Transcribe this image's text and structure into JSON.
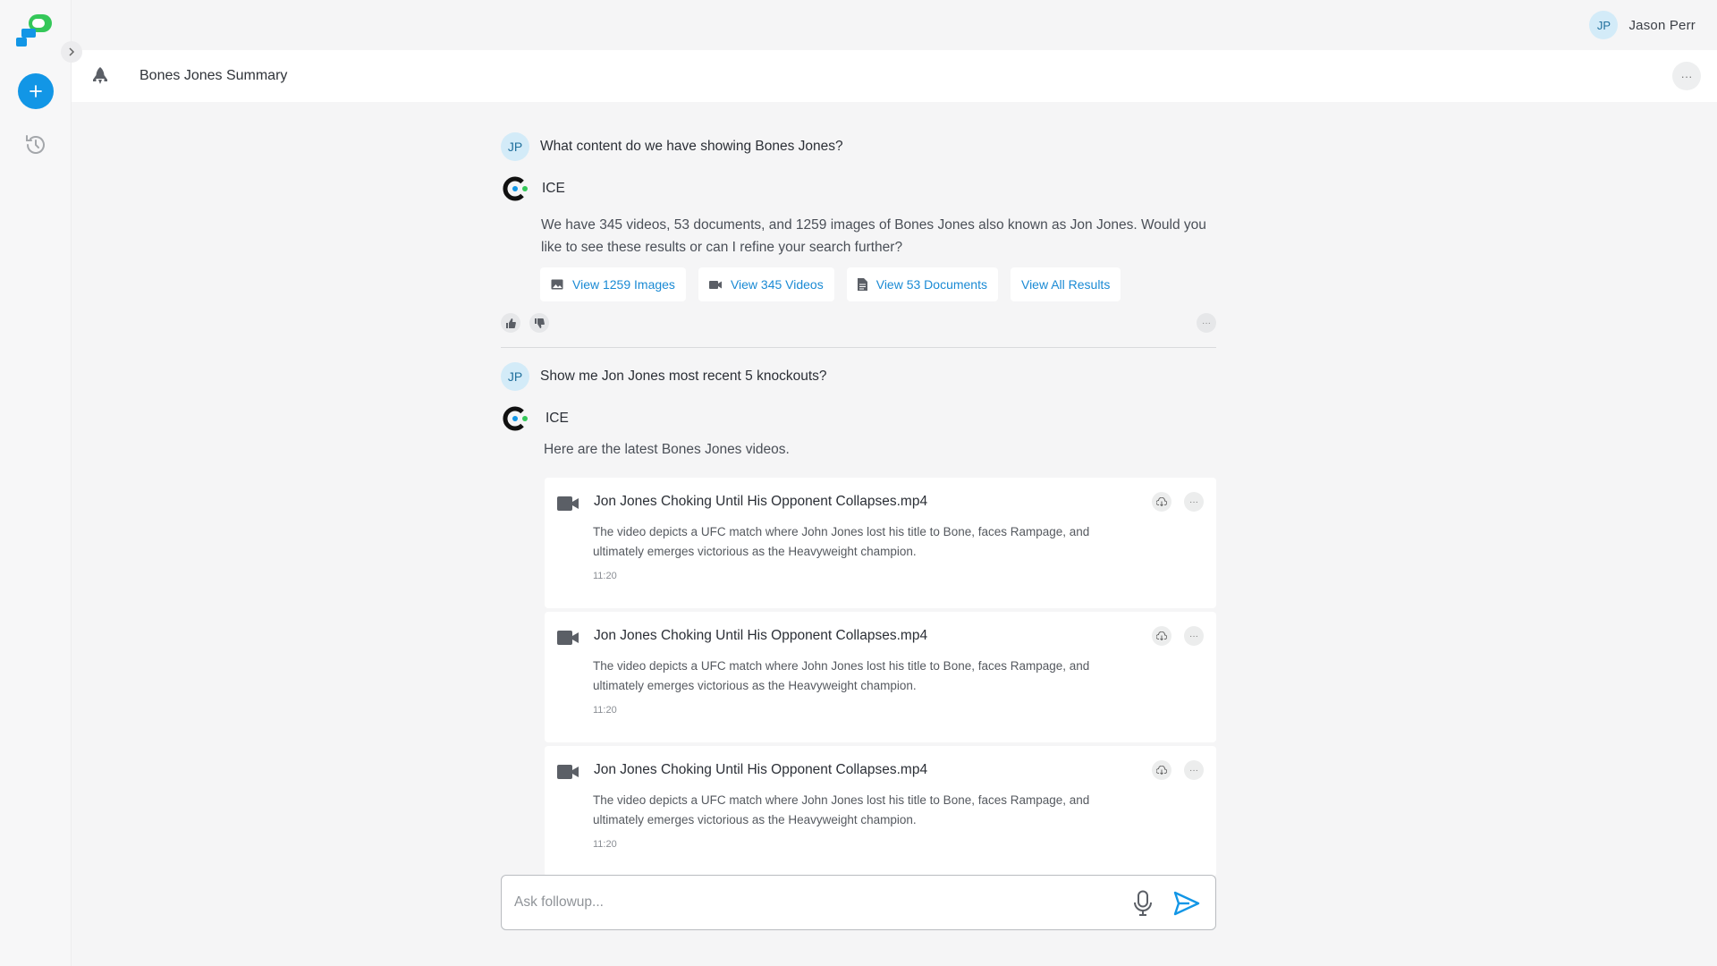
{
  "user": {
    "initials": "JP",
    "name": "Jason Perr"
  },
  "title_bar": {
    "title": "Bones Jones Summary",
    "menu_label": "···"
  },
  "thread": [
    {
      "question": "What content do we have showing Bones Jones?",
      "assistant_name": "ICE",
      "answer": "We have 345 videos, 53 documents, and 1259 images of Bones Jones also known as Jon Jones. Would you like to see these results or can I refine your search further?",
      "actions": [
        {
          "label": "View 1259 Images",
          "icon": "image-icon"
        },
        {
          "label": "View 345 Videos",
          "icon": "video-icon"
        },
        {
          "label": "View 53 Documents",
          "icon": "document-icon"
        },
        {
          "label": "View All Results",
          "icon": ""
        }
      ]
    },
    {
      "question": "Show me Jon Jones most recent 5 knockouts?",
      "assistant_name": "ICE",
      "answer": "Here are the latest Bones Jones videos."
    }
  ],
  "videos": [
    {
      "title": "Jon Jones Choking Until His Opponent Collapses.mp4",
      "description": "The video depicts a UFC match where John Jones lost his title to Bone, faces Rampage, and ultimately emerges victorious as the Heavyweight champion.",
      "duration": "11:20"
    },
    {
      "title": "Jon Jones Choking Until His Opponent Collapses.mp4",
      "description": "The video depicts a UFC match where John Jones lost his title to Bone, faces Rampage, and ultimately emerges victorious as the Heavyweight champion.",
      "duration": "11:20"
    },
    {
      "title": "Jon Jones Choking Until His Opponent Collapses.mp4",
      "description": "The video depicts a UFC match where John Jones lost his title to Bone, faces Rampage, and ultimately emerges victorious as the Heavyweight champion.",
      "duration": "11:20"
    }
  ],
  "composer": {
    "placeholder": "Ask followup..."
  },
  "colors": {
    "accent": "#1296e6",
    "link": "#1a8ad4",
    "avatar_bg": "#d3ebf8",
    "logo_green": "#34c759"
  }
}
